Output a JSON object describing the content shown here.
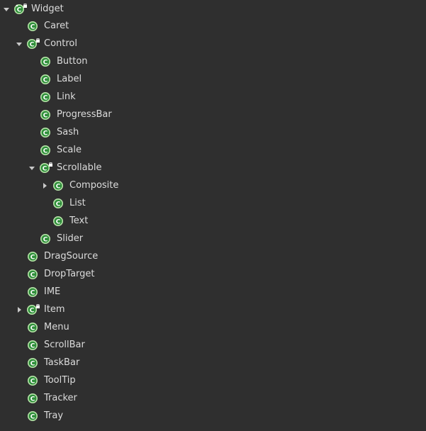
{
  "colors": {
    "background": "#2f2f2f",
    "text": "#dcdcdc",
    "class_icon_fill": "#2f8f3a",
    "class_icon_ring": "#b6e3a8",
    "class_icon_letter": "#ffffff",
    "twisty": "#c8c8c8"
  },
  "tree": {
    "nodes": [
      {
        "label": "Widget",
        "icon": "abstract-class-icon",
        "state": "expanded"
      },
      {
        "label": "Caret",
        "icon": "class-icon",
        "state": "leaf"
      },
      {
        "label": "Control",
        "icon": "abstract-class-icon",
        "state": "expanded"
      },
      {
        "label": "Button",
        "icon": "class-icon",
        "state": "leaf"
      },
      {
        "label": "Label",
        "icon": "class-icon",
        "state": "leaf"
      },
      {
        "label": "Link",
        "icon": "class-icon",
        "state": "leaf"
      },
      {
        "label": "ProgressBar",
        "icon": "class-icon",
        "state": "leaf"
      },
      {
        "label": "Sash",
        "icon": "class-icon",
        "state": "leaf"
      },
      {
        "label": "Scale",
        "icon": "class-icon",
        "state": "leaf"
      },
      {
        "label": "Scrollable",
        "icon": "abstract-class-icon",
        "state": "expanded"
      },
      {
        "label": "Composite",
        "icon": "class-icon",
        "state": "collapsed"
      },
      {
        "label": "List",
        "icon": "class-icon",
        "state": "leaf"
      },
      {
        "label": "Text",
        "icon": "class-icon",
        "state": "leaf"
      },
      {
        "label": "Slider",
        "icon": "class-icon",
        "state": "leaf"
      },
      {
        "label": "DragSource",
        "icon": "class-icon",
        "state": "leaf"
      },
      {
        "label": "DropTarget",
        "icon": "class-icon",
        "state": "leaf"
      },
      {
        "label": "IME",
        "icon": "class-icon",
        "state": "leaf"
      },
      {
        "label": "Item",
        "icon": "abstract-class-icon",
        "state": "collapsed"
      },
      {
        "label": "Menu",
        "icon": "class-icon",
        "state": "leaf"
      },
      {
        "label": "ScrollBar",
        "icon": "class-icon",
        "state": "leaf"
      },
      {
        "label": "TaskBar",
        "icon": "class-icon",
        "state": "leaf"
      },
      {
        "label": "ToolTip",
        "icon": "class-icon",
        "state": "leaf"
      },
      {
        "label": "Tracker",
        "icon": "class-icon",
        "state": "leaf"
      },
      {
        "label": "Tray",
        "icon": "class-icon",
        "state": "leaf"
      }
    ]
  }
}
